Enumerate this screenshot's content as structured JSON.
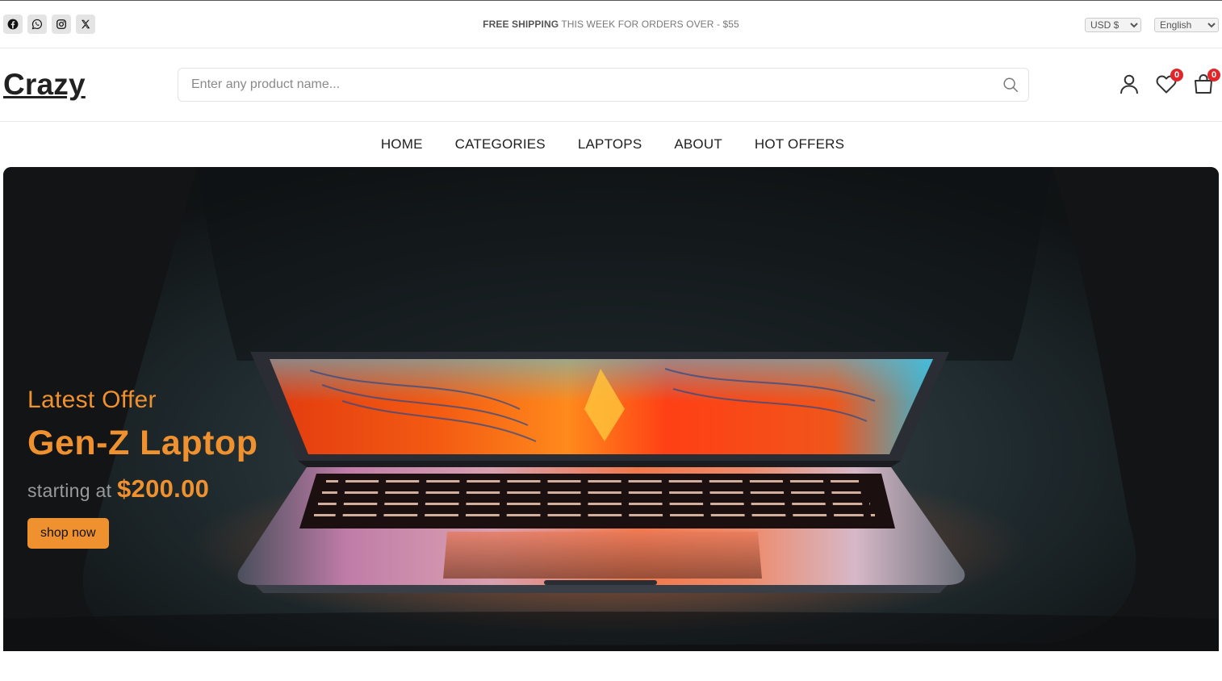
{
  "topbar": {
    "social": [
      {
        "icon": "facebook-icon"
      },
      {
        "icon": "whatsapp-icon"
      },
      {
        "icon": "instagram-icon"
      },
      {
        "icon": "x-twitter-icon"
      }
    ],
    "alert_bold": "FREE SHIPPING",
    "alert_rest": " THIS WEEK FOR ORDERS OVER - $55",
    "currency": "USD $",
    "language": "English"
  },
  "header": {
    "logo": "Crazy",
    "search_placeholder": "Enter any product name...",
    "wishlist_count": "0",
    "cart_count": "0"
  },
  "nav": {
    "items": [
      "HOME",
      "CATEGORIES",
      "LAPTOPS",
      "ABOUT",
      "HOT OFFERS"
    ]
  },
  "banner": {
    "subtitle": "Latest Offer",
    "title": "Gen-Z Laptop",
    "price_prefix": "starting at ",
    "price": "$200.00",
    "button": "shop now"
  },
  "colors": {
    "accent": "#f0912f",
    "badge": "#e0262a",
    "text": "#212121"
  }
}
